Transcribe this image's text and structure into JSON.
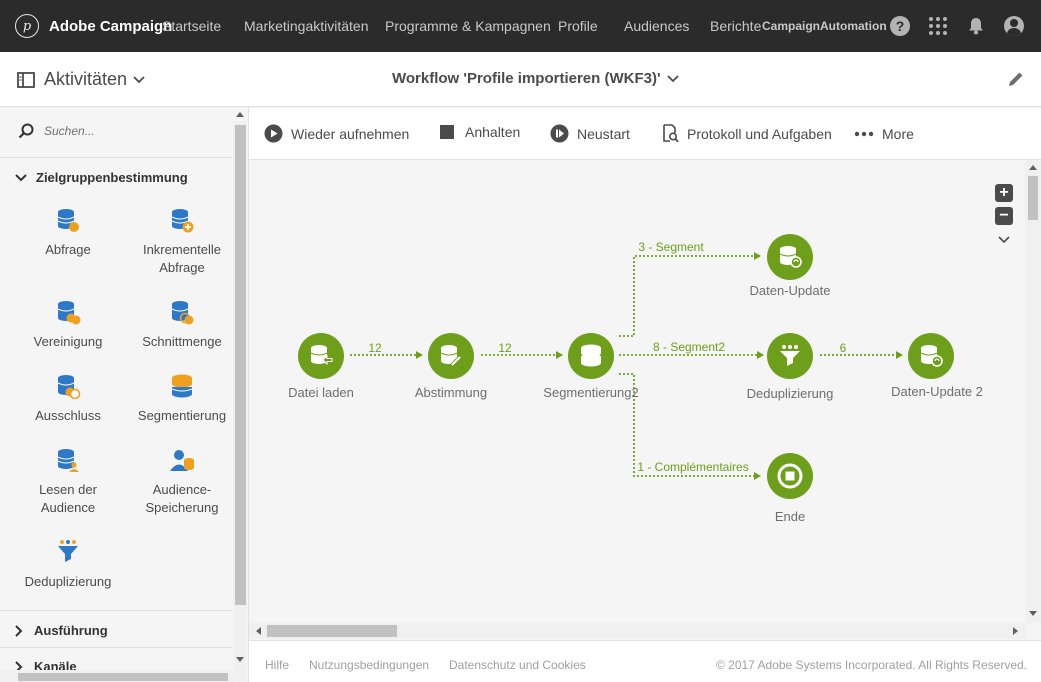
{
  "topbar": {
    "brand": "Adobe Campaign",
    "nav": [
      "Startseite",
      "Marketingaktivitäten",
      "Programme & Kampagnen",
      "Profile",
      "Audiences",
      "Berichte"
    ],
    "instance": "CampaignAutomation"
  },
  "subheader": {
    "activities_label": "Aktivitäten",
    "workflow_title": "Workflow 'Profile importieren (WKF3)'"
  },
  "sidebar": {
    "search_placeholder": "Suchen...",
    "category_open": "Zielgruppenbestimmung",
    "tiles": [
      {
        "label": "Abfrage",
        "icon": "query-icon"
      },
      {
        "label": "Inkrementelle Abfrage",
        "icon": "incremental-query-icon"
      },
      {
        "label": "Vereinigung",
        "icon": "union-icon"
      },
      {
        "label": "Schnittmenge",
        "icon": "intersection-icon"
      },
      {
        "label": "Ausschluss",
        "icon": "exclusion-icon"
      },
      {
        "label": "Segmentierung",
        "icon": "segmentation-icon"
      },
      {
        "label": "Lesen der Audience",
        "icon": "read-audience-icon"
      },
      {
        "label": "Audience-Speicherung",
        "icon": "save-audience-icon"
      },
      {
        "label": "Deduplizierung",
        "icon": "deduplication-icon"
      }
    ],
    "category_execution": "Ausführung",
    "category_channels": "Kanäle"
  },
  "toolbar": {
    "resume": "Wieder aufnehmen",
    "stop": "Anhalten",
    "restart": "Neustart",
    "log": "Protokoll und Aufgaben",
    "more": "More"
  },
  "workflow": {
    "nodes": [
      {
        "id": "load",
        "label": "Datei laden"
      },
      {
        "id": "reconcile",
        "label": "Abstimmung"
      },
      {
        "id": "segment",
        "label": "Segmentierung2"
      },
      {
        "id": "update1",
        "label": "Daten-Update"
      },
      {
        "id": "dedup",
        "label": "Deduplizierung"
      },
      {
        "id": "update2",
        "label": "Daten-Update 2"
      },
      {
        "id": "end",
        "label": "Ende"
      }
    ],
    "edges": [
      {
        "label": "12"
      },
      {
        "label": "12"
      },
      {
        "label": "3 - Segment"
      },
      {
        "label": "8 - Segment2"
      },
      {
        "label": "6"
      },
      {
        "label": "1 - Complémentaires"
      }
    ]
  },
  "footer": {
    "help": "Hilfe",
    "terms": "Nutzungsbedingungen",
    "privacy": "Datenschutz und Cookies",
    "copyright": "© 2017 Adobe Systems Incorporated. All Rights Reserved."
  },
  "colors": {
    "topbar": "#2b2b2b",
    "node_green": "#6d9f1b",
    "icon_blue": "#2d78c8",
    "icon_orange": "#f0a020"
  }
}
